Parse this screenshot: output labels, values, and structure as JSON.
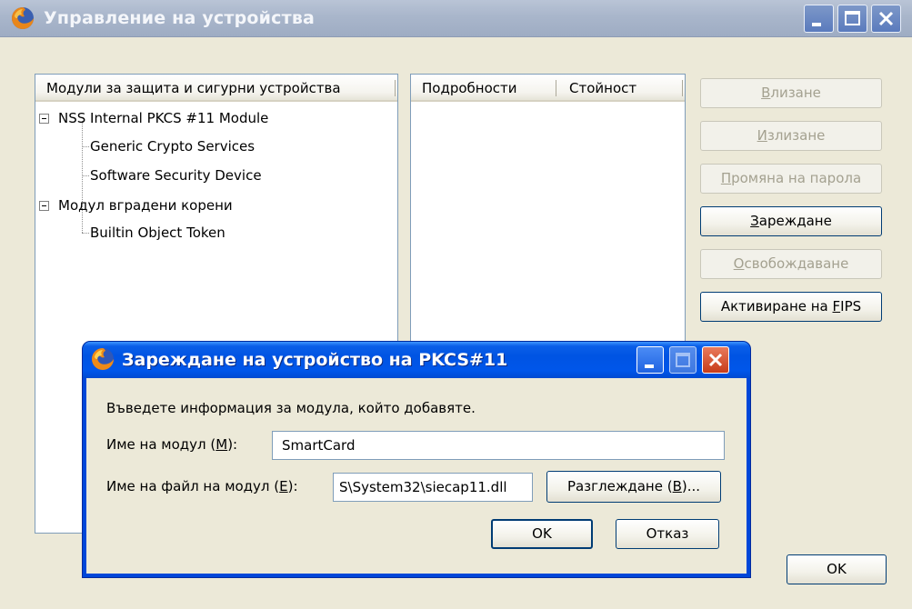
{
  "main_window": {
    "title": "Управление на устройства",
    "modules_header": "Модули за защита и сигурни устройства",
    "details_header": "Подробности",
    "value_header": "Стойност",
    "tree": [
      {
        "label": "NSS Internal PKCS #11 Module",
        "level": 0,
        "expanded": true
      },
      {
        "label": "Generic Crypto Services",
        "level": 1
      },
      {
        "label": "Software Security Device",
        "level": 1
      },
      {
        "label": "Модул вградени корени",
        "level": 0,
        "expanded": true
      },
      {
        "label": "Builtin Object Token",
        "level": 1
      }
    ],
    "buttons": {
      "login": {
        "pre": "",
        "u": "В",
        "post": "лизане"
      },
      "logout": {
        "pre": "",
        "u": "И",
        "post": "злизане"
      },
      "change_password": {
        "pre": "",
        "u": "П",
        "post": "ромяна на парола"
      },
      "load": {
        "pre": "",
        "u": "З",
        "post": "ареждане"
      },
      "unload": {
        "pre": "",
        "u": "О",
        "post": "свобождаване"
      },
      "enable_fips": {
        "pre": "Активиране на ",
        "u": "F",
        "post": "IPS"
      },
      "ok": "OK"
    }
  },
  "dialog": {
    "title": "Зареждане на устройство на PKCS#11",
    "intro": "Въведете информация за модула, който добавяте.",
    "module_name_label": {
      "pre": "Име на модул (",
      "u": "М",
      "post": "):"
    },
    "module_name_value": "SmartCard",
    "module_file_label": {
      "pre": "Име на файл на модул (",
      "u": "Е",
      "post": "):"
    },
    "module_file_value": "S\\System32\\siecap11.dll",
    "browse_button": {
      "pre": "Разглеждане (",
      "u": "В",
      "post": ")..."
    },
    "ok_button": "OK",
    "cancel_button": "Отказ"
  }
}
